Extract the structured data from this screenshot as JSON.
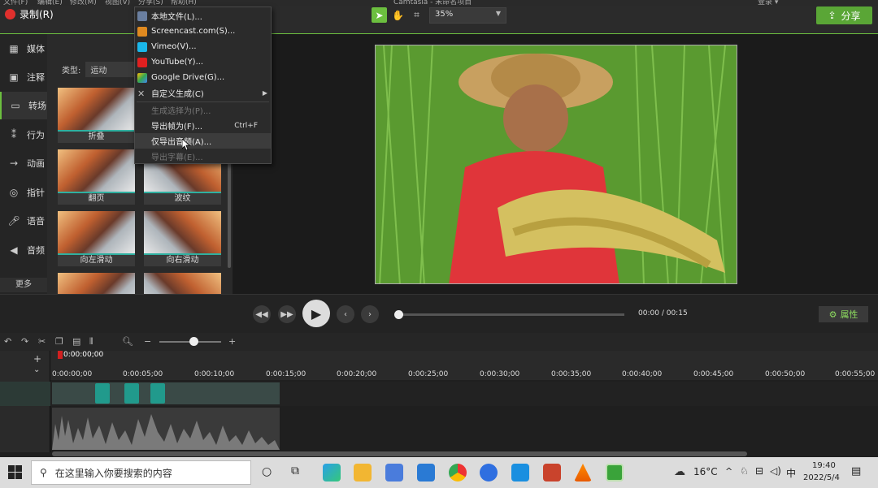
{
  "menubar": {
    "items": [
      "文件(F)",
      "编辑(E)",
      "修改(M)",
      "视图(V)",
      "分享(S)",
      "帮助(H)"
    ],
    "title": "Camtasia - 未命名项目",
    "login": "登录 ▾"
  },
  "header": {
    "record_label": "录制(R)",
    "zoom": "35%",
    "share_label": "分享"
  },
  "share_menu": {
    "items": [
      {
        "label": "本地文件(L)...",
        "icon": "film-icon",
        "color": "#6a7fa0",
        "disabled": false
      },
      {
        "label": "Screencast.com(S)...",
        "icon": "screencast-icon",
        "color": "#e08a20",
        "disabled": false
      },
      {
        "label": "Vimeo(V)...",
        "icon": "vimeo-icon",
        "color": "#1ab7ea",
        "disabled": false
      },
      {
        "label": "YouTube(Y)...",
        "icon": "youtube-icon",
        "color": "#e02020",
        "disabled": false
      },
      {
        "label": "Google Drive(G)...",
        "icon": "google-drive-icon",
        "color": "#34a853",
        "disabled": false
      },
      {
        "label": "自定义生成(C)",
        "icon": "tools-icon",
        "color": "#bbbbbb",
        "disabled": false,
        "submenu": true
      },
      {
        "label": "生成选择为(P)...",
        "disabled": true
      },
      {
        "label": "导出帧为(F)...",
        "shortcut": "Ctrl+F",
        "disabled": false
      },
      {
        "label": "仅导出音频(A)...",
        "disabled": false,
        "hovered": true
      },
      {
        "label": "导出字幕(E)...",
        "disabled": true
      }
    ]
  },
  "sidebar": {
    "items": [
      {
        "label": "媒体",
        "icon": "film-strip-icon"
      },
      {
        "label": "注释",
        "icon": "annotation-icon"
      },
      {
        "label": "转场",
        "icon": "transition-icon",
        "selected": true
      },
      {
        "label": "行为",
        "icon": "behavior-icon"
      },
      {
        "label": "动画",
        "icon": "animation-icon"
      },
      {
        "label": "指针",
        "icon": "cursor-icon"
      },
      {
        "label": "语音",
        "icon": "microphone-icon"
      },
      {
        "label": "音频",
        "icon": "speaker-icon"
      }
    ],
    "more": "更多"
  },
  "library": {
    "filter_label": "类型:",
    "filter_value": "运动",
    "items": [
      "折叠",
      "",
      "翻页",
      "波纹",
      "向左滑动",
      "向右滑动",
      "",
      ""
    ]
  },
  "player": {
    "time_current": "00:00",
    "time_sep": "/",
    "time_total": "00:15",
    "properties_label": "属性"
  },
  "timeline": {
    "playhead": "0:00:00;00",
    "ticks": [
      "0:00:00;00",
      "0:00:05;00",
      "0:00:10;00",
      "0:00:15;00",
      "0:00:20;00",
      "0:00:25;00",
      "0:00:30;00",
      "0:00:35;00",
      "0:00:40;00",
      "0:00:45;00",
      "0:00:50;00",
      "0:00:55;00"
    ]
  },
  "taskbar": {
    "search_placeholder": "在这里输入你要搜索的内容",
    "weather": "16°C",
    "ime": "中",
    "time": "19:40",
    "date": "2022/5/4"
  },
  "colors": {
    "accent": "#6cbf3f",
    "transition_bar": "#2fb0a0",
    "clip": "#219a8c",
    "record": "#e0302d"
  }
}
